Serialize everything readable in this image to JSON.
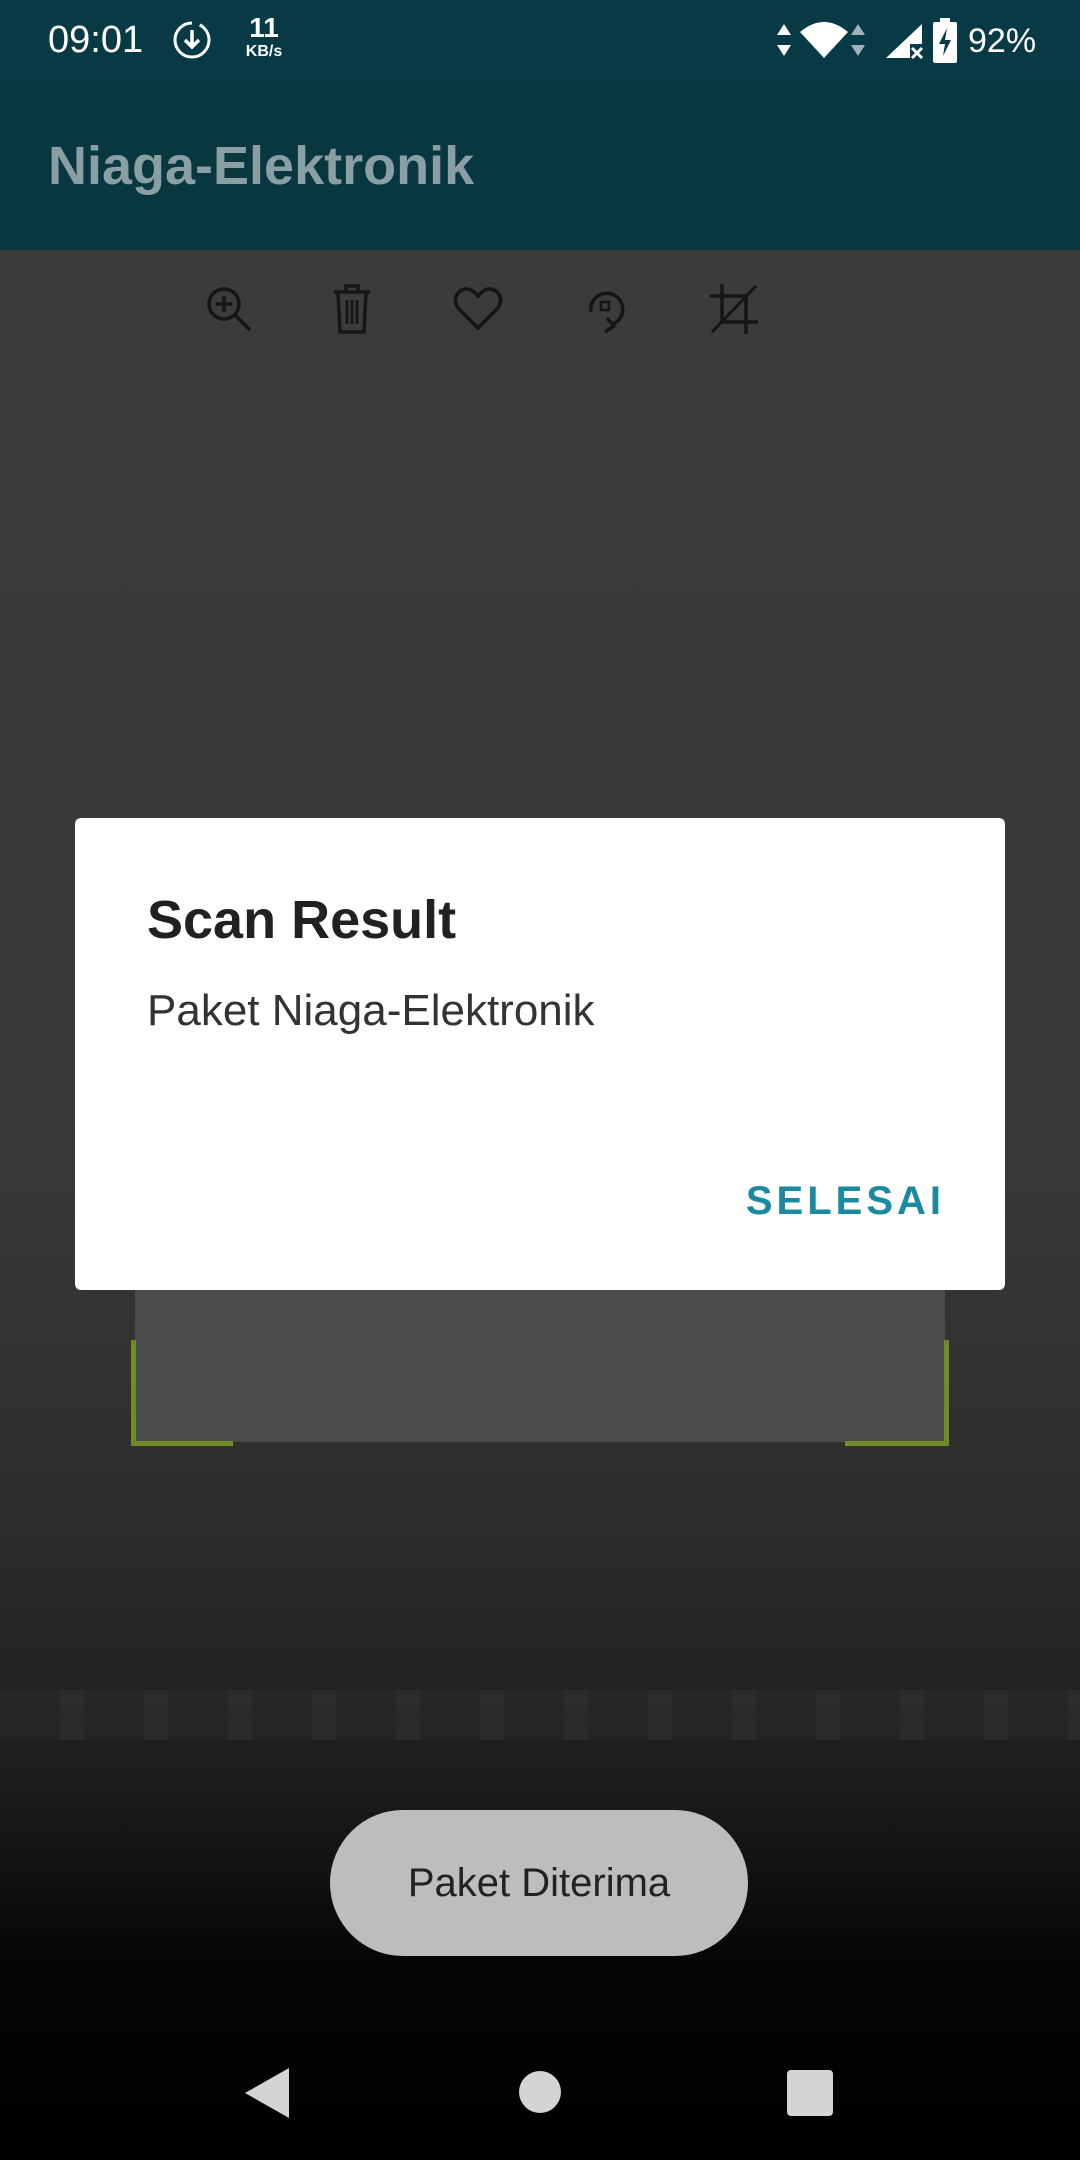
{
  "status_bar": {
    "time": "09:01",
    "speed_value": "11",
    "speed_unit": "KB/s",
    "battery_percent": "92%",
    "icons": [
      "download-icon",
      "data-arrows-icon",
      "wifi-icon",
      "signal-icon",
      "battery-charging-icon"
    ]
  },
  "app_bar": {
    "title": "Niaga-Elektronik"
  },
  "camera_toolbar": {
    "icons": [
      "zoom-in-icon",
      "trash-icon",
      "heart-icon",
      "rotate-icon",
      "crop-off-icon"
    ]
  },
  "dialog": {
    "title": "Scan Result",
    "message": "Paket Niaga-Elektronik",
    "button_label": "SELESAI",
    "button_color": "#1a8aa1"
  },
  "toast": {
    "message": "Paket Diterima"
  },
  "nav_bar": {
    "icons": [
      "back-icon",
      "home-icon",
      "recents-icon"
    ]
  },
  "colors": {
    "status_bar": "#073a44",
    "app_bar": "#09373f",
    "scan_corner": "#6f8c28"
  }
}
